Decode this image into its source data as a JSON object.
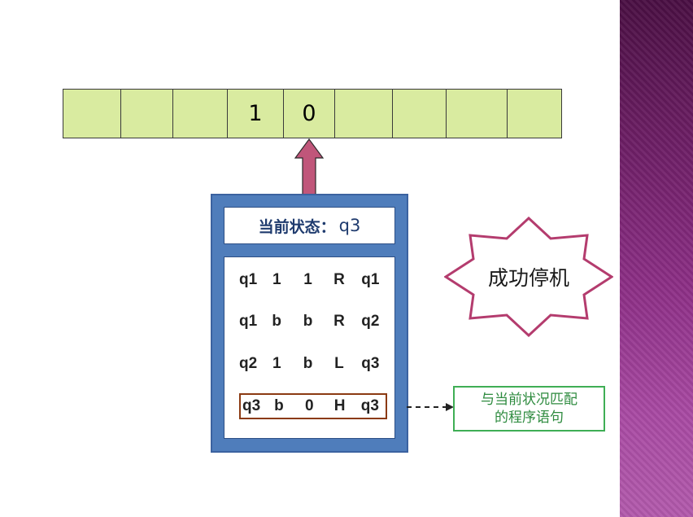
{
  "tape": {
    "cells": [
      "",
      "",
      "",
      "1",
      "0",
      "",
      "",
      "",
      ""
    ]
  },
  "machine": {
    "state_label": "当前状态：",
    "state_value": "q3",
    "rules": [
      [
        "q1",
        "1",
        "1",
        "R",
        "q1"
      ],
      [
        "q1",
        "b",
        "b",
        "R",
        "q2"
      ],
      [
        "q2",
        "1",
        "b",
        "L",
        "q3"
      ],
      [
        "q3",
        "b",
        "0",
        "H",
        "q3"
      ]
    ]
  },
  "star": {
    "text": "成功停机"
  },
  "note": {
    "line1": "与当前状况匹配",
    "line2": "的程序语句"
  },
  "colors": {
    "tape_fill": "#d9eba0",
    "machine_fill": "#4f7dbb",
    "arrow_fill": "#c0567a",
    "star_outline": "#b43c6e",
    "note_green": "#3fae55",
    "highlight_border": "#8b3a12",
    "stripe_purple": "#7a2572"
  }
}
